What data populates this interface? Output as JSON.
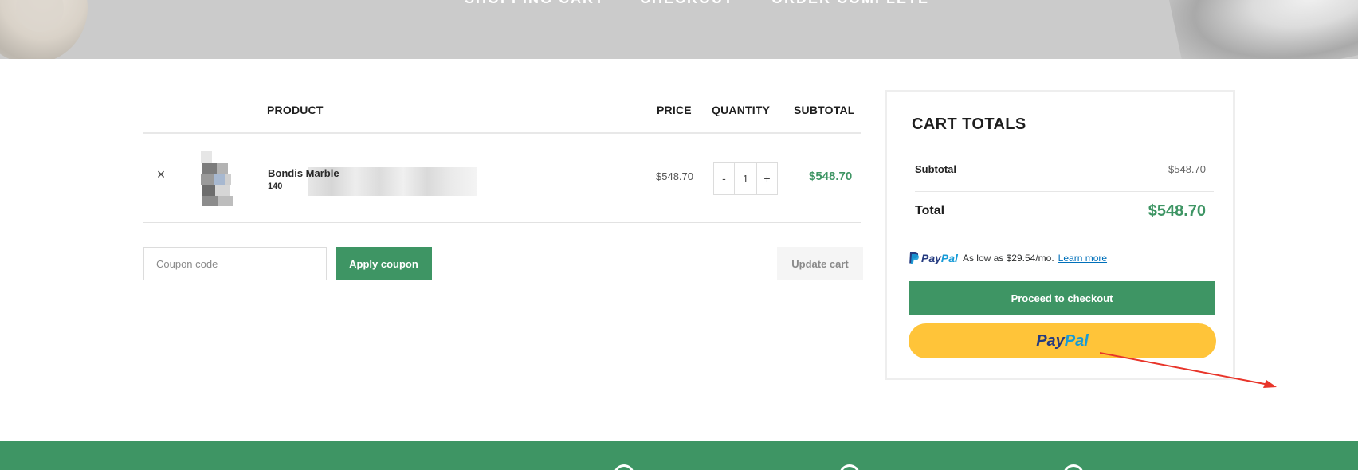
{
  "steps": {
    "cart": "SHOPPING CART",
    "checkout": "CHECKOUT",
    "complete": "ORDER COMPLETE"
  },
  "table": {
    "headers": {
      "product": "PRODUCT",
      "price": "PRICE",
      "quantity": "QUANTITY",
      "subtotal": "SUBTOTAL"
    },
    "rows": [
      {
        "remove_icon": "×",
        "name_line1": "Bondis Marble",
        "name_line2": "140",
        "price": "$548.70",
        "qty_minus": "-",
        "quantity": "1",
        "qty_plus": "+",
        "subtotal": "$548.70"
      }
    ]
  },
  "actions": {
    "coupon_placeholder": "Coupon code",
    "apply_coupon": "Apply coupon",
    "update_cart": "Update cart"
  },
  "totals": {
    "title": "CART TOTALS",
    "subtotal_label": "Subtotal",
    "subtotal_value": "$548.70",
    "total_label": "Total",
    "total_value": "$548.70",
    "paypal_brand_a": "Pay",
    "paypal_brand_b": "Pal",
    "paypal_message": "As low as $29.54/mo.",
    "learn_more": "Learn more",
    "proceed": "Proceed to checkout"
  },
  "colors": {
    "accent": "#3e9564",
    "paypal_yellow": "#ffc439",
    "paypal_dark_blue": "#253b80",
    "paypal_light_blue": "#179bd7",
    "annotation_arrow": "#e8352a"
  }
}
